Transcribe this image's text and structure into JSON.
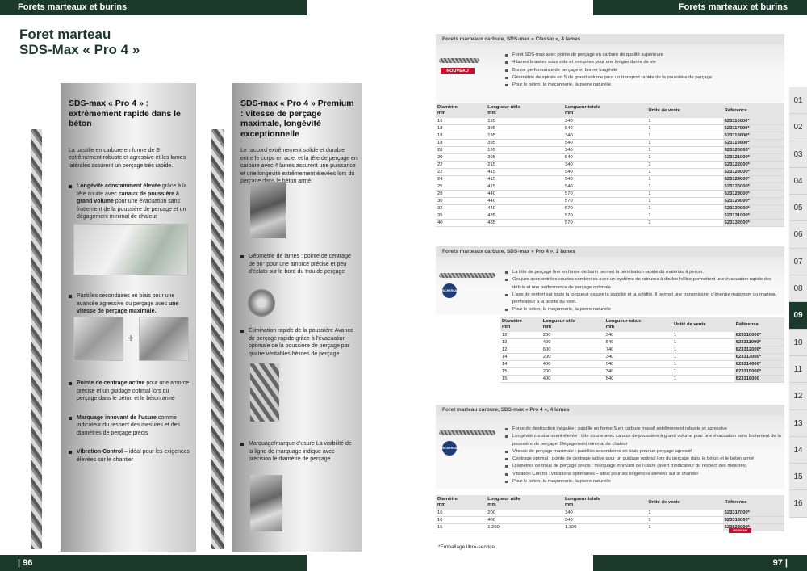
{
  "header": {
    "left": "Forets marteaux et burins",
    "right": "Forets marteaux et burins"
  },
  "footer": {
    "left_page": "| 96",
    "right_page": "97 |"
  },
  "page_title": "Foret marteau\nSDS-Max « Pro 4 »",
  "col1": {
    "title": "SDS-max « Pro 4 » : extrêmement rapide dans le béton",
    "intro": "La pastille en carbure en forme de S extrêmement robuste et agressive et les lames latérales assurent un perçage très rapide.",
    "b1_bold": "Longévité constamment élevée",
    "b1_mid": " grâce à la tête courte avec ",
    "b1_bold2": "canaux de poussière à grand volume",
    "b1_rest": " pour une évacuation sans frottement de la poussière de perçage et un dégagement minimal de chaleur",
    "b2_text": "Pastilles secondaires en biais pour une avancée agressive du perçage avec ",
    "b2_bold": "une vitesse de perçage maximale.",
    "b3_bold": "Pointe de centrage active",
    "b3_rest": " pour une amorce précise et un guidage optimal lors du perçage dans le béton et le béton armé",
    "b4_bold": "Marquage innovant de l'usure",
    "b4_rest": " comme indicateur du respect des mesures et des diamètres de perçage précis",
    "b5_bold": "Vibration Control",
    "b5_rest": " – idéal pour les exigences élevées sur le chantier",
    "plus": "+"
  },
  "col2": {
    "title": "SDS-max « Pro 4 » Premium : vitesse de perçage maximale, longévité exceptionnelle",
    "intro": "Le raccord extrêmement solide et durable entre le corps en acier et la tête de perçage en carbure avec 4 lames assurent une puissance et une longévité extrêmement élevées lors du perçage dans le béton armé.",
    "b1": "Géométrie de lames : pointe de centrage de 90° pour une amorce précise et peu d'éclats sur le bord du trou de perçage",
    "b2": "Élimination rapide de la poussière Avance de perçage rapide grâce à l'évacuation optimale de la poussière de perçage par quatre véritables hélices de perçage",
    "b3": "Marquage/marque d'usure La visibilité de la ligne de marquage indique avec précision le diamètre de perçage"
  },
  "sections": [
    {
      "title": "Forets marteaux carbure, SDS-max « Classic », 4 lames",
      "badge": "NOUVEAU",
      "features": [
        "Foret SDS-max avec pointe de perçage en carbure de qualité supérieure",
        "4 lames brasées sous vide et trempées pour une longue durée de vie",
        "Bonne performance de perçage et bonne longévité",
        "Géométrie de spirale en S de grand volume pour un transport rapide de la poussière de perçage",
        "Pour le béton, la maçonnerie, la pierre naturelle"
      ],
      "headers": [
        "Diamètre\nmm",
        "Longueur utile\nmm",
        "Longueur totale\nmm",
        "Unité de vente",
        "Référence"
      ],
      "rows": [
        [
          "16",
          "195",
          "340",
          "1",
          "623116000*"
        ],
        [
          "18",
          "395",
          "540",
          "1",
          "623117000*"
        ],
        [
          "18",
          "195",
          "340",
          "1",
          "623118000*"
        ],
        [
          "18",
          "395",
          "540",
          "1",
          "623119000*"
        ],
        [
          "20",
          "195",
          "340",
          "1",
          "623120000*"
        ],
        [
          "20",
          "395",
          "540",
          "1",
          "623121000*"
        ],
        [
          "22",
          "215",
          "340",
          "1",
          "623122000*"
        ],
        [
          "22",
          "415",
          "540",
          "1",
          "623123000*"
        ],
        [
          "24",
          "415",
          "540",
          "1",
          "623124000*"
        ],
        [
          "25",
          "415",
          "540",
          "1",
          "623125000*"
        ],
        [
          "28",
          "440",
          "570",
          "1",
          "623128000*"
        ],
        [
          "30",
          "440",
          "570",
          "1",
          "623129000*"
        ],
        [
          "32",
          "440",
          "570",
          "1",
          "623130000*"
        ],
        [
          "35",
          "435",
          "570",
          "1",
          "623131000*"
        ],
        [
          "40",
          "435",
          "570",
          "1",
          "623132000*"
        ]
      ]
    },
    {
      "title": "Forets marteaux carbure, SDS-max « Pro 4 », 2 lames",
      "logo": "SICHERSAFE",
      "features": [
        "La tête de perçage fine en forme de burin permet la pénétration rapide du matériau à percer.",
        "Goujure avec entrées courtes combinées avec un système de rainures à double hélice permettent une évacuation rapide des débris et une performance de perçage optimale",
        "L'axe de renfort sur toute la longueur assure la stabilité et la solidité. Il permet une transmission d'énergie maximum du marteau perforateur à la pointe du foret.",
        "Pour le béton, la maçonnerie, la pierre naturelle"
      ],
      "headers": [
        "Diamètre\nmm",
        "Longueur utile\nmm",
        "Longueur totale\nmm",
        "Unité de vente",
        "Référence"
      ],
      "rows": [
        [
          "12",
          "200",
          "340",
          "1",
          "623310000*"
        ],
        [
          "12",
          "400",
          "540",
          "1",
          "623311000*"
        ],
        [
          "12",
          "600",
          "740",
          "1",
          "623312000*"
        ],
        [
          "14",
          "200",
          "340",
          "1",
          "623313000*"
        ],
        [
          "14",
          "400",
          "540",
          "1",
          "623314000*"
        ],
        [
          "15",
          "200",
          "340",
          "1",
          "623315000*"
        ],
        [
          "15",
          "400",
          "540",
          "1",
          "623316000"
        ]
      ]
    },
    {
      "title": "Foret marteau carbure, SDS-max « Pro 4 », 4 lames",
      "logo": "SICHERSAFE",
      "features": [
        "Force de destruction inégalée : pastille en forme S en carbure massif extrêmement robuste et agressive",
        "Longévité constamment élevée : tête courte avec canaux de poussière à grand volume pour une évacuation sans frottement de la poussière de perçage. Dégagement minimal de chaleur",
        "Vitesse de perçage maximale : pastilles secondaires en biais pour un perçage agressif",
        "Centrage optimal : pointe de centrage active pour un guidage optimal lors du perçage dans le béton et le béton armé",
        "Diamètres de trous de perçage précis : marquage innovant de l'usure (avert d'indicateur du respect des mesures)",
        "Vibration Control : vibrations optimisées – idéal pour les exigences élevées sur le chantier",
        "Pour le béton, la maçonnerie, la pierre naturelle"
      ],
      "headers": [
        "Diamètre\nmm",
        "Longueur utile\nmm",
        "Longueur totale\nmm",
        "Unité de vente",
        "Référence"
      ],
      "rows": [
        [
          "16",
          "200",
          "340",
          "1",
          "623317000*"
        ],
        [
          "16",
          "400",
          "540",
          "1",
          "623318000*"
        ],
        [
          "16",
          "1.200",
          "1.320",
          "1",
          "623823000*"
        ]
      ]
    }
  ],
  "footnote": "*Emballage libre-service",
  "tabs": [
    "01",
    "02",
    "03",
    "04",
    "05",
    "06",
    "07",
    "08",
    "09",
    "10",
    "11",
    "12",
    "13",
    "14",
    "15",
    "16"
  ],
  "active_tab": "09",
  "colors": {
    "brand_green": "#1c3a2b",
    "badge_red": "#c8102e"
  }
}
